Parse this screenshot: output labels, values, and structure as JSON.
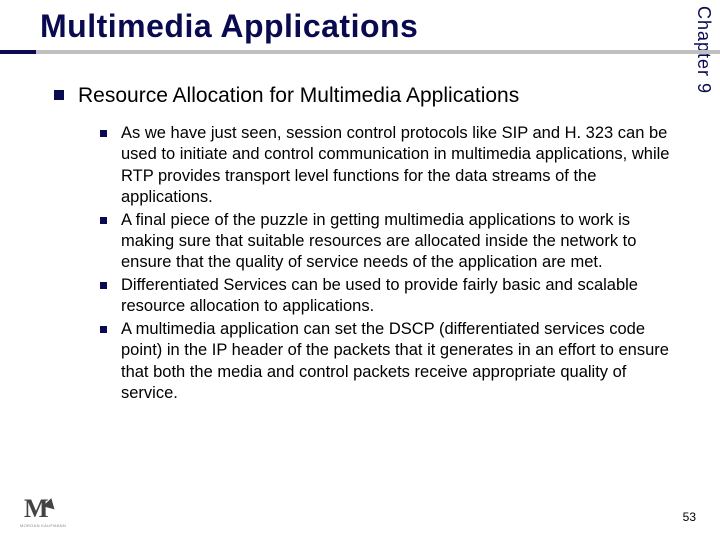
{
  "chapter_label": "Chapter 9",
  "title": "Multimedia Applications",
  "section": {
    "heading": "Resource Allocation for Multimedia Applications",
    "bullets": [
      "As we have just seen, session control protocols like SIP and H. 323 can be used to initiate and control communication in multimedia applications, while RTP provides transport level functions for the data streams of the applications.",
      "A final piece of the puzzle in getting multimedia applications to work is making sure that suitable resources are allocated inside the network to ensure that the quality of service needs of the application are met.",
      "Differentiated Services can be used to provide fairly basic and scalable resource allocation to applications.",
      "A multimedia application can set the DSCP (differentiated services code point) in the IP header of the packets that it generates in an effort to ensure that both the media and control packets receive appropriate quality of service."
    ]
  },
  "publisher_mark": "M",
  "publisher_sub": "MORGAN KAUFMANN",
  "page_number": "53"
}
